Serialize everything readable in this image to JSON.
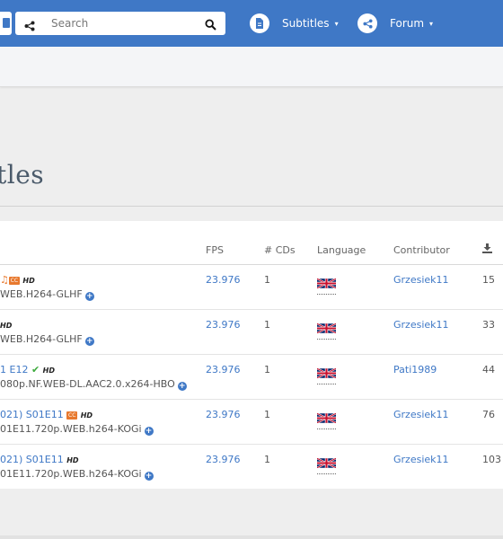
{
  "nav": {
    "search_placeholder": "Search",
    "subtitles_label": "Subtitles",
    "forum_label": "Forum",
    "caret": "▾"
  },
  "page": {
    "title": "tles"
  },
  "table": {
    "headers": {
      "fps": "FPS",
      "cds": "# CDs",
      "language": "Language",
      "contributor": "Contributor"
    },
    "rows": [
      {
        "line2": "WEB.H264-GLHF",
        "fps": "23.976",
        "cds": "1",
        "contributor": "Grzesiek11",
        "downloads": "15"
      },
      {
        "line2": "WEB.H264-GLHF",
        "fps": "23.976",
        "cds": "1",
        "contributor": "Grzesiek11",
        "downloads": "33"
      },
      {
        "line1": "1 E12",
        "line2": "080p.NF.WEB-DL.AAC2.0.x264-HBO",
        "fps": "23.976",
        "cds": "1",
        "contributor": "Pati1989",
        "downloads": "44"
      },
      {
        "line1": "021) S01E11",
        "line2": "01E11.720p.WEB.h264-KOGi",
        "fps": "23.976",
        "cds": "1",
        "contributor": "Grzesiek11",
        "downloads": "76"
      },
      {
        "line1": "021) S01E11",
        "line2": "01E11.720p.WEB.h264-KOGi",
        "fps": "23.976",
        "cds": "1",
        "contributor": "Grzesiek11",
        "downloads": "103"
      }
    ],
    "badges": {
      "hd": "HD",
      "cc": "CC",
      "plus": "+",
      "check": "✔",
      "note": "♫"
    }
  },
  "colors": {
    "brand": "#3F78C6",
    "accent": "#E8792E",
    "ok": "#3DAA3D"
  }
}
